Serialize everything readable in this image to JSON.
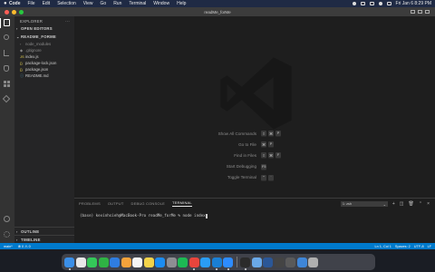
{
  "menubar": {
    "app_name": "Code",
    "items": [
      "File",
      "Edit",
      "Selection",
      "View",
      "Go",
      "Run",
      "Terminal",
      "Window",
      "Help"
    ],
    "clock": "Fri Jan 6  8:29 PM"
  },
  "window": {
    "title": "readMe_forMe"
  },
  "sidebar": {
    "header": "EXPLORER",
    "header_more": "···",
    "open_editors": "OPEN EDITORS",
    "project": "README_FORME",
    "files": [
      {
        "name": "node_modules",
        "icon": "folder-icon",
        "glyph": "›",
        "dim": true
      },
      {
        "name": ".gitignore",
        "icon": "git-icon",
        "glyph": "◆",
        "dim": true
      },
      {
        "name": "index.js",
        "icon": "js-icon",
        "glyph": "JS",
        "dim": false
      },
      {
        "name": "package-lock.json",
        "icon": "json-icon",
        "glyph": "{}",
        "dim": false
      },
      {
        "name": "package.json",
        "icon": "json-icon",
        "glyph": "{}",
        "dim": false
      },
      {
        "name": "README.md",
        "icon": "markdown-icon",
        "glyph": "ⓘ",
        "dim": false
      }
    ],
    "outline": "OUTLINE",
    "timeline": "TIMELINE"
  },
  "editor": {
    "watermark_icon": "vscode-logo-icon",
    "shortcuts": [
      {
        "label": "Show All Commands",
        "keys": [
          "⇧",
          "⌘",
          "P"
        ]
      },
      {
        "label": "Go to File",
        "keys": [
          "⌘",
          "P"
        ]
      },
      {
        "label": "Find in Files",
        "keys": [
          "⇧",
          "⌘",
          "F"
        ]
      },
      {
        "label": "Start Debugging",
        "keys": [
          "F5"
        ]
      },
      {
        "label": "Toggle Terminal",
        "keys": [
          "⌃",
          "`"
        ]
      }
    ]
  },
  "panel": {
    "tabs": [
      "PROBLEMS",
      "OUTPUT",
      "DEBUG CONSOLE",
      "TERMINAL"
    ],
    "active_tab": "TERMINAL",
    "terminal_select": "1: zsh",
    "terminal_prompt": "(base) kevinhsieh@MacBook-Pro readMe_forMe % node index"
  },
  "statusbar": {
    "branch": "main*",
    "problems": "⊗ 0  ⚠ 0",
    "right_items": [
      "Ln 1, Col 1",
      "Spaces: 2",
      "UTF-8",
      "LF"
    ]
  },
  "dock": {
    "apps": [
      {
        "name": "finder",
        "color": "#3b8fe8"
      },
      {
        "name": "launchpad",
        "color": "#e8e8e8"
      },
      {
        "name": "messages",
        "color": "#34c759"
      },
      {
        "name": "facetime",
        "color": "#2fb344"
      },
      {
        "name": "mail",
        "color": "#2f7de1"
      },
      {
        "name": "photos",
        "color": "#f4a23b"
      },
      {
        "name": "calendar",
        "color": "#f5f5f5"
      },
      {
        "name": "notes",
        "color": "#f3d34a"
      },
      {
        "name": "app-store",
        "color": "#1c8cf0"
      },
      {
        "name": "system-preferences",
        "color": "#8e8e93"
      },
      {
        "name": "spotify",
        "color": "#1db954"
      },
      {
        "name": "chrome",
        "color": "#e8453c"
      },
      {
        "name": "safari",
        "color": "#2a9df4"
      },
      {
        "name": "vscode",
        "color": "#1a7fd4"
      },
      {
        "name": "zoom",
        "color": "#2d8cff"
      },
      {
        "name": "terminal",
        "color": "#2b2b2b"
      },
      {
        "name": "preview",
        "color": "#6aa9e9"
      },
      {
        "name": "word",
        "color": "#2b5797"
      },
      {
        "name": "github",
        "color": "#444444"
      },
      {
        "name": "activity",
        "color": "#5a5a5a"
      },
      {
        "name": "downloads",
        "color": "#3f86d8"
      },
      {
        "name": "trash",
        "color": "#b0b0b0"
      }
    ]
  }
}
